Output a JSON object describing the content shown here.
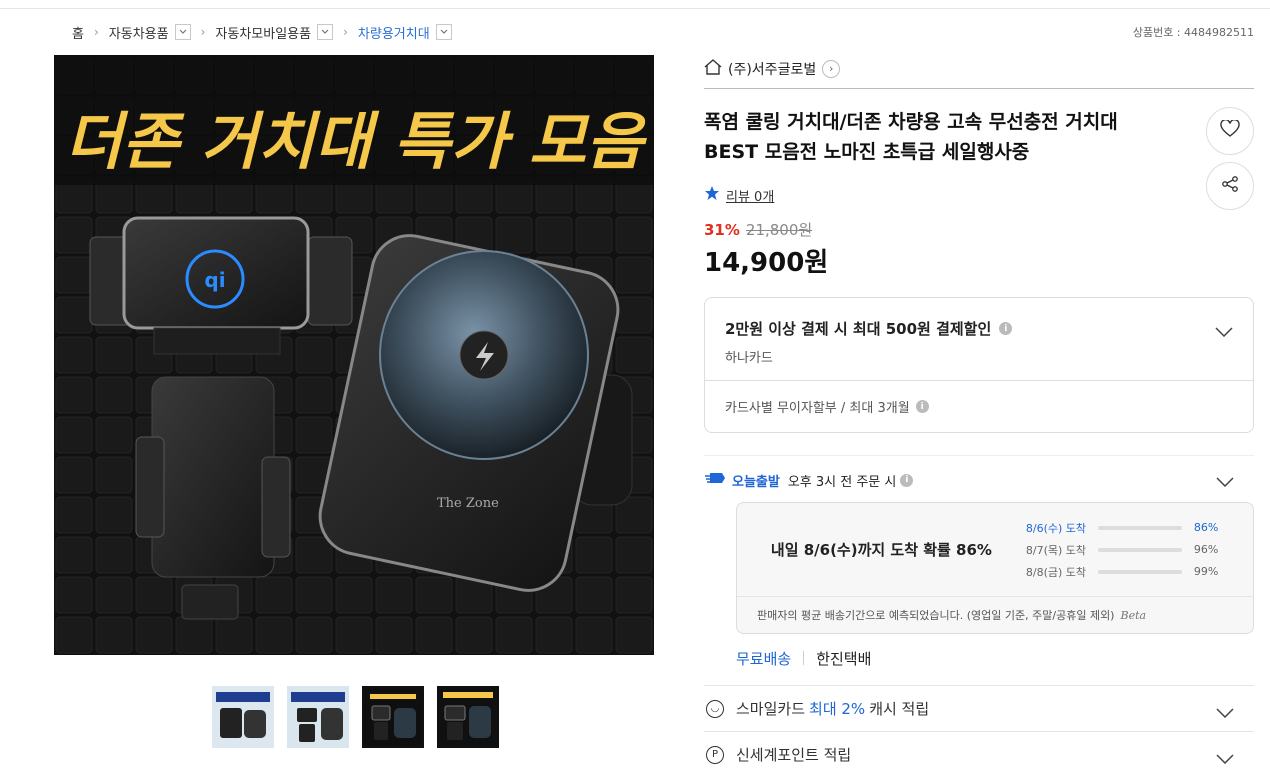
{
  "breadcrumb": {
    "home": "홈",
    "items": [
      "자동차용품",
      "자동차모바일용품",
      "차량용거치대"
    ]
  },
  "product_number": "상품번호 : 4484982511",
  "main_image": {
    "banner_text": "더존 거치대 특가 모음",
    "brand_text": "The Zone"
  },
  "thumbnails": [
    "thumb-1",
    "thumb-2",
    "thumb-3",
    "thumb-4"
  ],
  "seller": {
    "name": "(주)서주글로벌"
  },
  "product": {
    "title_line1": "폭염 쿨링 거치대/더존 차량용 고속 무선충전 거치대",
    "title_line2": "BEST 모음전 노마진 초특급 세일행사중",
    "review": "리뷰 0개",
    "discount_pct": "31%",
    "original_price": "21,800원",
    "price": "14,900원"
  },
  "card_benefit": {
    "headline": "2만원 이상 결제 시 최대 500원 결제할인",
    "card": "하나카드",
    "installment": "카드사별 무이자할부 / 최대 3개월"
  },
  "shipping": {
    "badge": "오늘출발",
    "condition": "오후 3시 전 주문 시",
    "summary": "내일 8/6(수)까지 도착 확률 86%",
    "rows": [
      {
        "date": "8/6(수) 도착",
        "pct": "86%",
        "value": 0.86
      },
      {
        "date": "8/7(목) 도착",
        "pct": "96%",
        "value": 0.96
      },
      {
        "date": "8/8(금) 도착",
        "pct": "99%",
        "value": 0.99
      }
    ],
    "note": "판매자의 평균 배송기간으로 예측되었습니다. (영업일 기준, 주말/공휴일 제외)",
    "beta": "Beta",
    "free": "무료배송",
    "courier": "한진택배"
  },
  "benefits": {
    "smile_prefix": "스마일카드",
    "smile_accent": "최대 2%",
    "smile_suffix": "캐시 적립",
    "ssg": "신세계포인트 적립"
  },
  "colors": {
    "accent": "#1f66d6",
    "sale": "#e0301e",
    "banner": "#f5c84a"
  }
}
